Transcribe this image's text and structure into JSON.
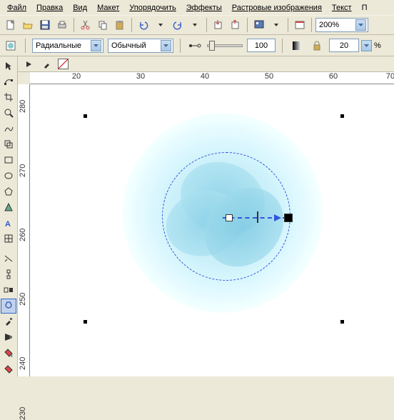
{
  "menu": {
    "file": "Файл",
    "edit": "Правка",
    "view": "Вид",
    "layout": "Макет",
    "arrange": "Упорядочить",
    "effects": "Эффекты",
    "bitmap": "Растровые изображения",
    "text": "Текст",
    "more": "П"
  },
  "toolbar": {
    "zoom": "200%"
  },
  "propbar": {
    "fill_type": "Радиальные",
    "wrap": "Обычный",
    "opacity": "100",
    "edge": "20",
    "pct": "%"
  },
  "ruler": {
    "h": [
      "20",
      "30",
      "40",
      "50",
      "60",
      "70"
    ],
    "v": [
      "280",
      "270",
      "260",
      "250",
      "240",
      "230"
    ]
  }
}
